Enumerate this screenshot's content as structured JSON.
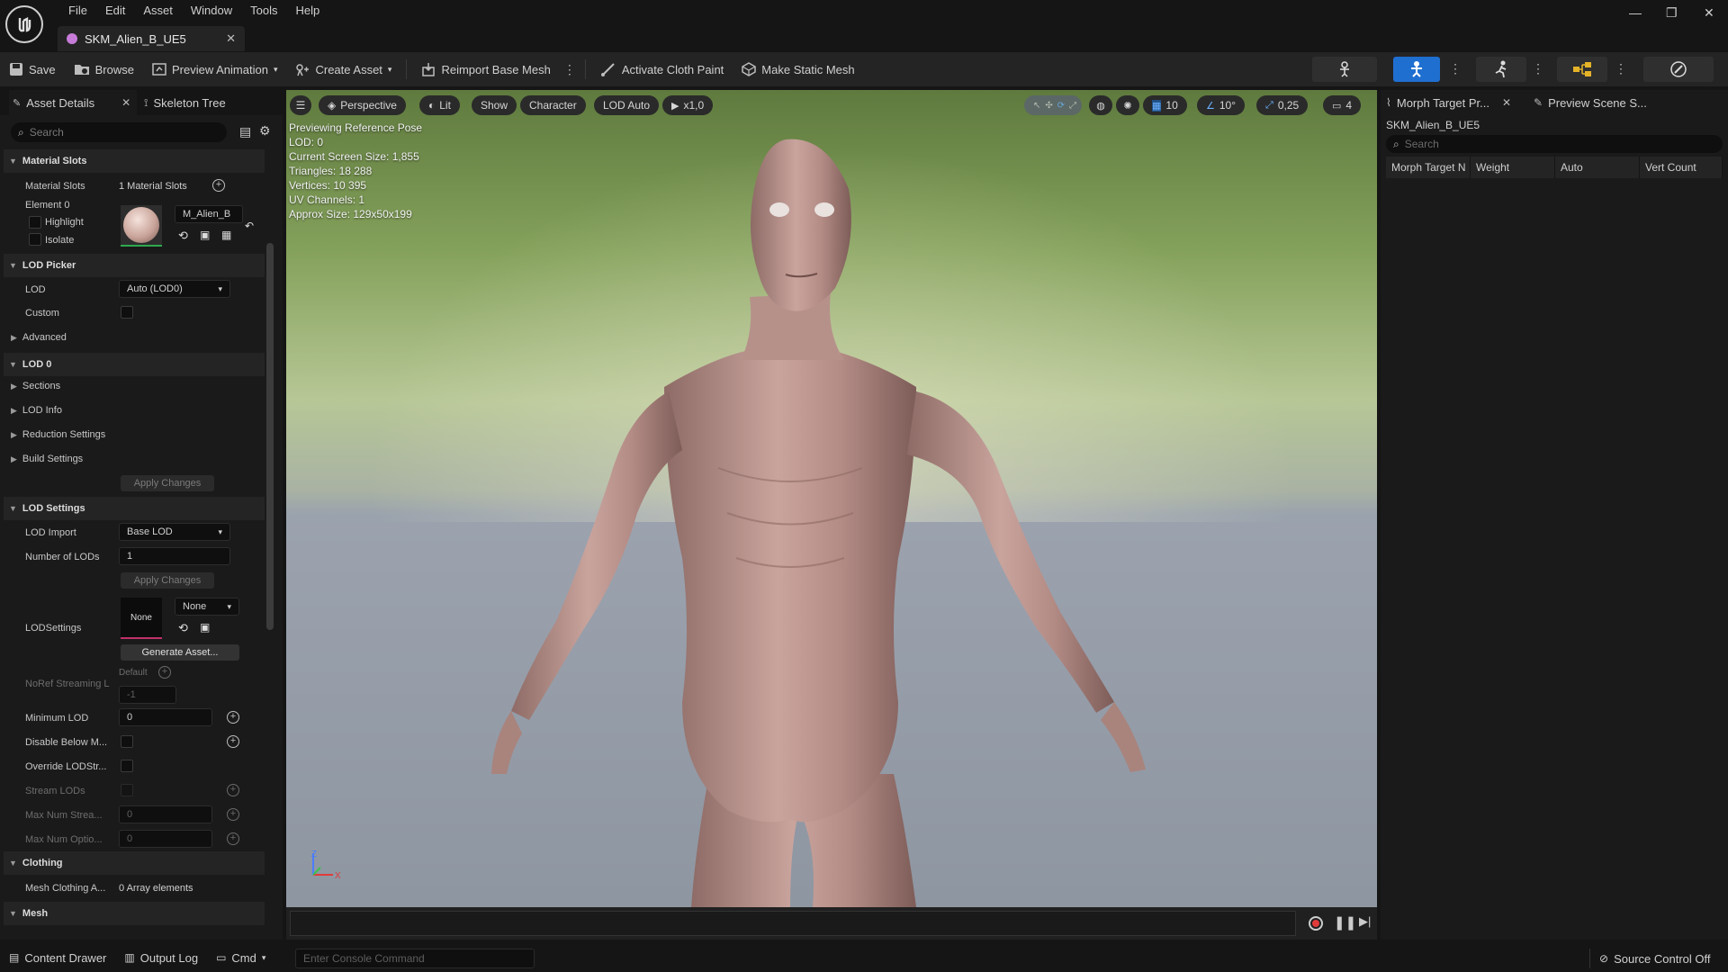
{
  "menu": [
    "File",
    "Edit",
    "Asset",
    "Window",
    "Tools",
    "Help"
  ],
  "doc_tab": {
    "label": "SKM_Alien_B_UE5"
  },
  "toolbar": {
    "save": "Save",
    "browse": "Browse",
    "preview_animation": "Preview Animation",
    "create_asset": "Create Asset",
    "reimport": "Reimport Base Mesh",
    "cloth_paint": "Activate Cloth Paint",
    "static_mesh": "Make Static Mesh"
  },
  "left_panel": {
    "tab_details": "Asset Details",
    "tab_skeleton": "Skeleton Tree",
    "search_placeholder": "Search",
    "material_slots_cat": "Material Slots",
    "material_slots_label": "Material Slots",
    "material_slots_value": "1 Material Slots",
    "element0": "Element 0",
    "highlight": "Highlight",
    "isolate": "Isolate",
    "material_name": "M_Alien_B",
    "lod_picker_cat": "LOD Picker",
    "lod_label": "LOD",
    "lod_value": "Auto (LOD0)",
    "custom": "Custom",
    "advanced": "Advanced",
    "lod0_cat": "LOD 0",
    "sections": "Sections",
    "lod_info": "LOD Info",
    "reduction": "Reduction Settings",
    "build": "Build Settings",
    "apply_changes": "Apply Changes",
    "lod_settings_cat": "LOD Settings",
    "lod_import": "LOD Import",
    "lod_import_value": "Base LOD",
    "num_lods": "Number of LODs",
    "num_lods_value": "1",
    "apply_changes2": "Apply Changes",
    "lodsettings": "LODSettings",
    "lodsettings_thumb": "None",
    "lodsettings_value": "None",
    "generate_asset": "Generate Asset...",
    "default": "Default",
    "noref": "NoRef Streaming L",
    "noref_value": "-1",
    "min_lod": "Minimum LOD",
    "min_lod_value": "0",
    "disable_below": "Disable Below M...",
    "override": "Override LODStr...",
    "stream_lods": "Stream LODs",
    "max_num_stream": "Max Num Strea...",
    "max_num_stream_value": "0",
    "max_num_optio": "Max Num Optio...",
    "max_num_optio_value": "0",
    "clothing_cat": "Clothing",
    "mesh_clothing": "Mesh Clothing A...",
    "mesh_clothing_value": "0 Array elements",
    "mesh_cat": "Mesh"
  },
  "viewport": {
    "perspective": "Perspective",
    "lit": "Lit",
    "show": "Show",
    "character": "Character",
    "lod_auto": "LOD Auto",
    "speed": "x1,0",
    "grid": "10",
    "angle": "10°",
    "scale": "0,25",
    "camera": "4",
    "info": [
      "Previewing Reference Pose",
      "LOD: 0",
      "Current Screen Size: 1,855",
      "Triangles: 18 288",
      "Vertices: 10 395",
      "UV Channels: 1",
      "Approx Size: 129x50x199"
    ],
    "axis_z": "Z",
    "axis_x": "X"
  },
  "right_panel": {
    "tab_morph": "Morph Target Pr...",
    "tab_scene": "Preview Scene S...",
    "asset_name": "SKM_Alien_B_UE5",
    "search_placeholder": "Search",
    "columns": [
      "Morph Target N",
      "Weight",
      "Auto",
      "Vert Count"
    ]
  },
  "statusbar": {
    "content_drawer": "Content Drawer",
    "output_log": "Output Log",
    "cmd": "Cmd",
    "console_placeholder": "Enter Console Command",
    "source_control": "Source Control Off"
  },
  "colors": {
    "accent_blue": "#1f6fd1",
    "bg": "#151515",
    "panel": "#1a1a1a"
  }
}
